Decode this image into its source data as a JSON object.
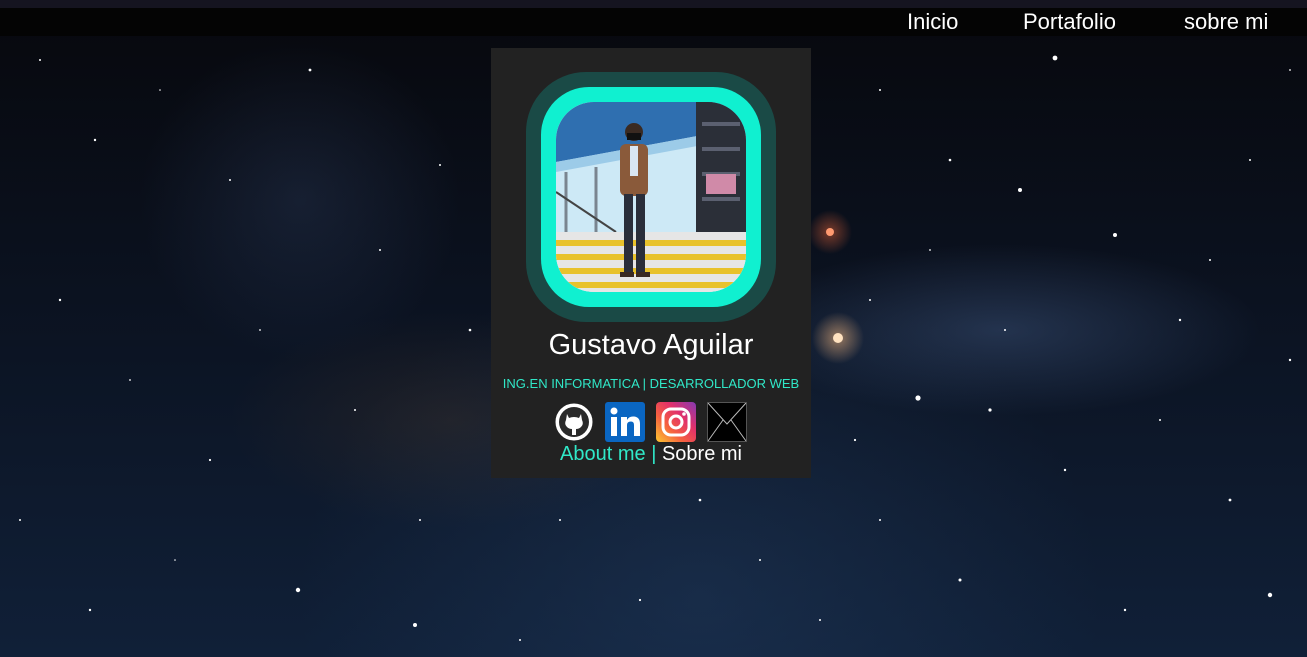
{
  "nav": {
    "items": [
      {
        "label": "Inicio"
      },
      {
        "label": "Portafolio"
      },
      {
        "label": "sobre mi"
      }
    ]
  },
  "profile": {
    "name": "Gustavo Aguilar",
    "subtitle": "ING.EN INFORMATICA | DESARROLLADOR WEB",
    "socials": [
      {
        "icon": "github-icon"
      },
      {
        "icon": "linkedin-icon"
      },
      {
        "icon": "instagram-icon"
      },
      {
        "icon": "email-icon"
      }
    ],
    "about_en": "About me",
    "about_sep": "|",
    "about_es": "Sobre mi"
  },
  "colors": {
    "accent": "#30e8c8",
    "ring": "#10f0d0",
    "card": "#222222",
    "navbar": "#040404"
  }
}
